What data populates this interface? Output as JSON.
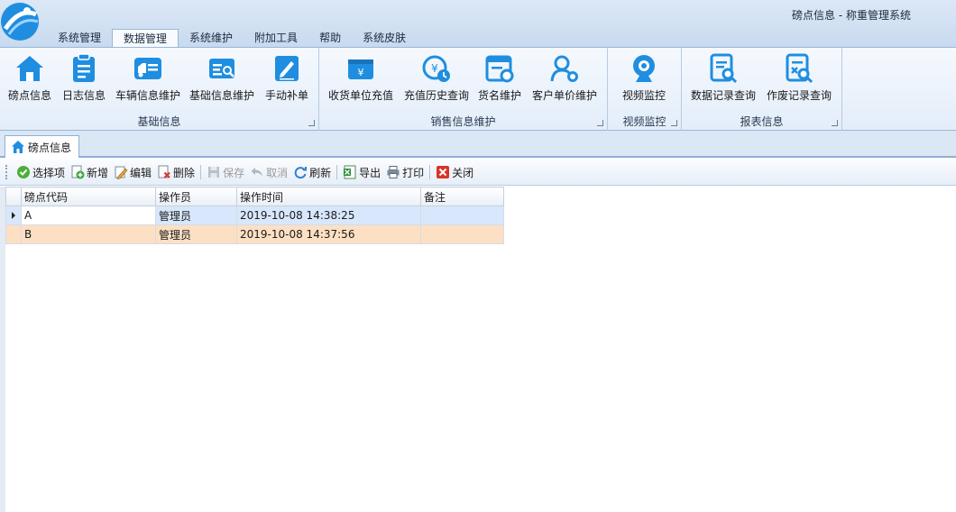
{
  "window": {
    "title": "磅点信息 - 称重管理系统"
  },
  "ribbon_tabs": [
    {
      "label": "系统管理"
    },
    {
      "label": "数据管理",
      "active": true
    },
    {
      "label": "系统维护"
    },
    {
      "label": "附加工具"
    },
    {
      "label": "帮助"
    },
    {
      "label": "系统皮肤"
    }
  ],
  "ribbon_groups": {
    "basic": {
      "label": "基础信息",
      "buttons": [
        {
          "label": "磅点信息",
          "icon": "home-icon"
        },
        {
          "label": "日志信息",
          "icon": "clipboard-icon"
        },
        {
          "label": "车辆信息维护",
          "icon": "truck-icon"
        },
        {
          "label": "基础信息维护",
          "icon": "edit-list-icon"
        },
        {
          "label": "手动补单",
          "icon": "edit-document-icon"
        }
      ]
    },
    "sales": {
      "label": "销售信息维护",
      "buttons": [
        {
          "label": "收货单位充值",
          "icon": "wallet-yen-icon"
        },
        {
          "label": "充值历史查询",
          "icon": "yen-history-icon"
        },
        {
          "label": "货名维护",
          "icon": "goods-settings-icon"
        },
        {
          "label": "客户单价维护",
          "icon": "user-settings-icon"
        }
      ]
    },
    "video": {
      "label": "视频监控",
      "buttons": [
        {
          "label": "视频监控",
          "icon": "webcam-icon"
        }
      ]
    },
    "report": {
      "label": "报表信息",
      "buttons": [
        {
          "label": "数据记录查询",
          "icon": "document-search-icon"
        },
        {
          "label": "作废记录查询",
          "icon": "document-cancel-search-icon"
        }
      ]
    }
  },
  "doc_tab": {
    "label": "磅点信息",
    "icon": "home-icon"
  },
  "toolbar": {
    "select": "选择项",
    "add": "新增",
    "edit": "编辑",
    "delete": "删除",
    "save": "保存",
    "cancel": "取消",
    "refresh": "刷新",
    "export": "导出",
    "print": "打印",
    "close": "关闭"
  },
  "grid": {
    "columns": [
      "磅点代码",
      "操作员",
      "操作时间",
      "备注"
    ],
    "rows": [
      {
        "code": "A",
        "operator": "管理员",
        "time": "2019-10-08 14:38:25",
        "remark": ""
      },
      {
        "code": "B",
        "operator": "管理员",
        "time": "2019-10-08 14:37:56",
        "remark": ""
      }
    ]
  },
  "colors": {
    "accent": "#1f8ee0",
    "selected_row": "#d8e7fb",
    "alt_row": "#fde0c4"
  }
}
